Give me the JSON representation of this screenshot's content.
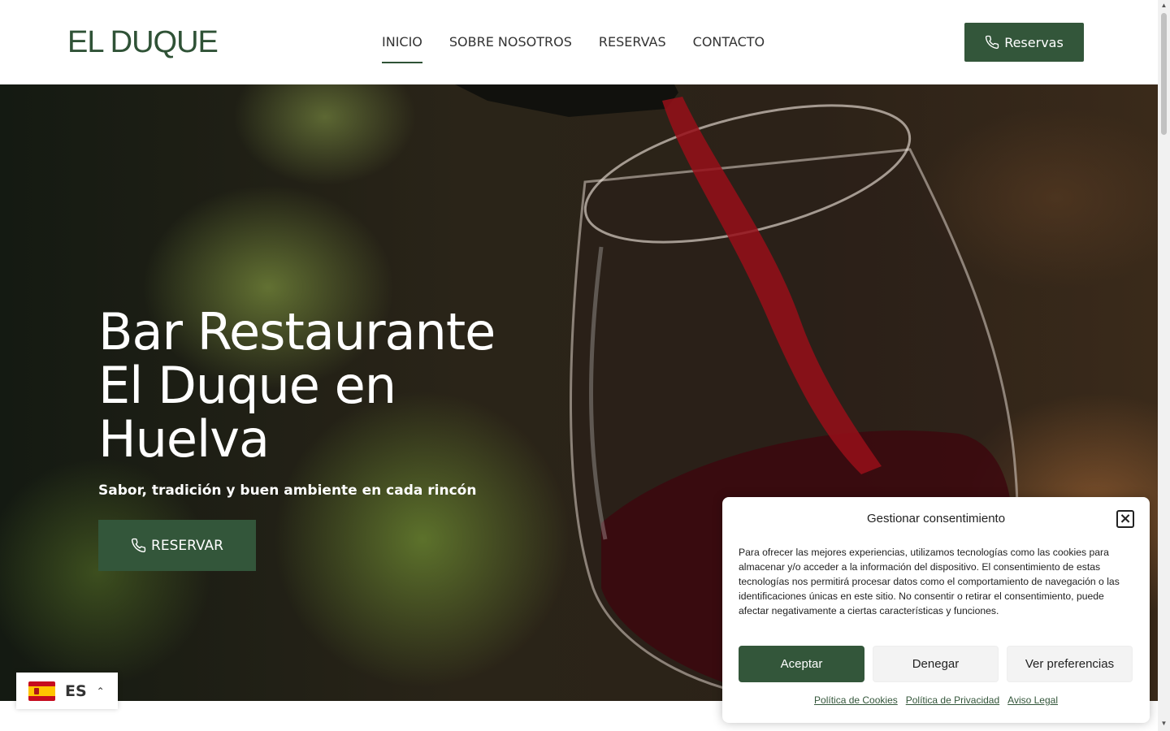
{
  "header": {
    "logo": "EL DUQUE",
    "nav": [
      "INICIO",
      "SOBRE NOSOTROS",
      "RESERVAS",
      "CONTACTO"
    ],
    "active_nav": "INICIO",
    "cta_label": "Reservas",
    "cta_icon": "phone-icon"
  },
  "hero": {
    "title": "Bar Restaurante El Duque en Huelva",
    "subtitle": "Sabor, tradición y buen ambiente en cada rincón",
    "button_label": "RESERVAR",
    "button_icon": "phone-icon"
  },
  "language": {
    "code": "ES",
    "flag": "spain-flag-icon"
  },
  "consent": {
    "title": "Gestionar consentimiento",
    "text": "Para ofrecer las mejores experiencias, utilizamos tecnologías como las cookies para almacenar y/o acceder a la información del dispositivo. El consentimiento de estas tecnologías nos permitirá procesar datos como el comportamiento de navegación o las identificaciones únicas en este sitio. No consentir o retirar el consentimiento, puede afectar negativamente a ciertas características y funciones.",
    "accept_label": "Aceptar",
    "deny_label": "Denegar",
    "prefs_label": "Ver preferencias",
    "links": [
      "Política de Cookies",
      "Política de Privacidad",
      "Aviso Legal"
    ]
  },
  "colors": {
    "brand_green": "#33563a",
    "logo_green": "#2f5236"
  }
}
